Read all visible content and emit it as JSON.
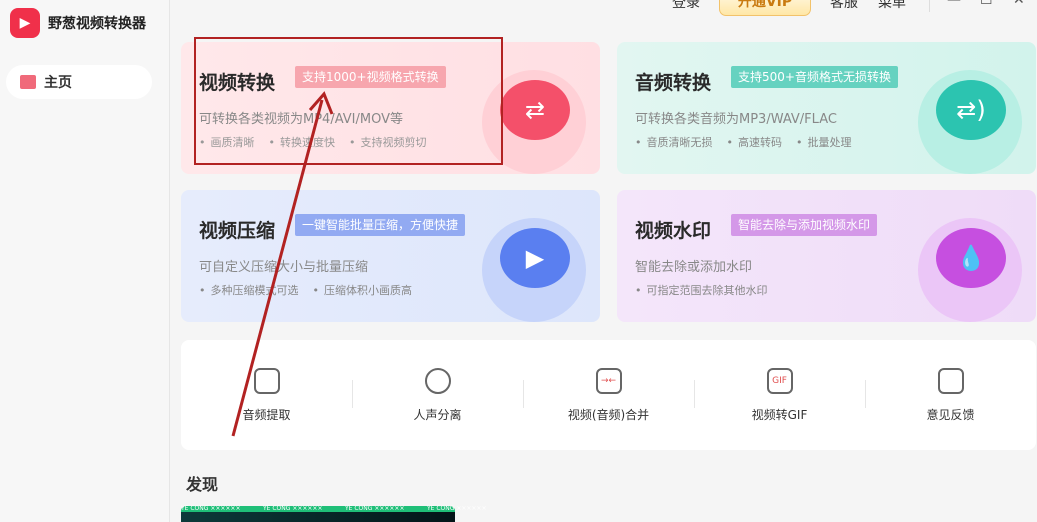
{
  "app": {
    "title": "野葱视频转换器",
    "logo_icon": "play-icon"
  },
  "sidebar": {
    "items": [
      {
        "label": "主页",
        "icon": "home-icon"
      }
    ]
  },
  "topbar": {
    "login": "登录",
    "vip": "开通VIP",
    "service": "客服",
    "menu": "菜单",
    "window": {
      "min": "—",
      "max": "☐",
      "close": "✕"
    }
  },
  "cards": [
    {
      "title": "视频转换",
      "tag": "支持1000+视频格式转换",
      "desc": "可转换各类视频为MP4/AVI/MOV等",
      "features": [
        "画质清晰",
        "转换速度快",
        "支持视频剪切"
      ],
      "icon": "video-convert-icon",
      "color": "#f26a80"
    },
    {
      "title": "音频转换",
      "tag": "支持500+音频格式无损转换",
      "desc": "可转换各类音频为MP3/WAV/FLAC",
      "features": [
        "音质清晰无损",
        "高速转码",
        "批量处理"
      ],
      "icon": "audio-convert-icon",
      "color": "#3cc8b4"
    },
    {
      "title": "视频压缩",
      "tag": "一键智能批量压缩，方便快捷",
      "desc": "可自定义压缩大小与批量压缩",
      "features": [
        "多种压缩模式可选",
        "压缩体积小画质高"
      ],
      "icon": "video-compress-icon",
      "color": "#6b8cf0"
    },
    {
      "title": "视频水印",
      "tag": "智能去除与添加视频水印",
      "desc": "智能去除或添加水印",
      "features": [
        "可指定范围去除其他水印"
      ],
      "icon": "watermark-icon",
      "color": "#c86ee0"
    }
  ],
  "tools": [
    {
      "label": "音频提取",
      "icon": "microphone-icon"
    },
    {
      "label": "人声分离",
      "icon": "voice-separate-icon"
    },
    {
      "label": "视频(音频)合并",
      "icon": "merge-icon"
    },
    {
      "label": "视频转GIF",
      "icon": "gif-icon",
      "badge": "GIF"
    },
    {
      "label": "意见反馈",
      "icon": "feedback-mail-icon"
    }
  ],
  "discover": {
    "title": "发现",
    "banner_text": "YE CONG ××××××"
  }
}
